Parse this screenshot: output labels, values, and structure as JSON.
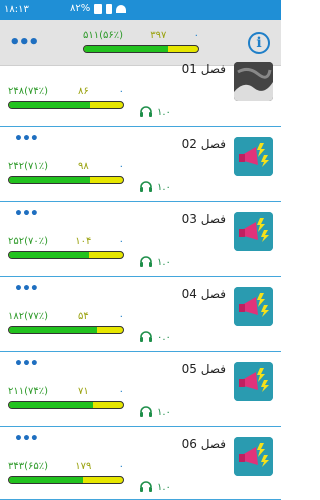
{
  "status": {
    "time": "۱۸:۱۳",
    "battery": "۸۲%"
  },
  "toolbar": {
    "total": "۵۱۱(۵۶٪)",
    "done": "۳۹۷",
    "zero": "۰",
    "progress": 0.74
  },
  "chapters": [
    {
      "title": "فصل 01",
      "total": "۲۴۸(۷۴٪)",
      "done": "۸۶",
      "zero": "۰",
      "speed": "۱.۰",
      "progress": 0.71,
      "thumb": "photo"
    },
    {
      "title": "فصل 02",
      "total": "۲۴۲(۷۱٪)",
      "done": "۹۸",
      "zero": "۰",
      "speed": "۱.۰",
      "progress": 0.71,
      "thumb": "megaphone"
    },
    {
      "title": "فصل 03",
      "total": "۲۵۲(۷۰٪)",
      "done": "۱۰۴",
      "zero": "۰",
      "speed": "۱.۰",
      "progress": 0.7,
      "thumb": "megaphone"
    },
    {
      "title": "فصل 04",
      "total": "۱۸۲(۷۷٪)",
      "done": "۵۴",
      "zero": "۰",
      "speed": "۰.۰",
      "progress": 0.77,
      "thumb": "megaphone"
    },
    {
      "title": "فصل 05",
      "total": "۲۱۱(۷۴٪)",
      "done": "۷۱",
      "zero": "۰",
      "speed": "۱.۰",
      "progress": 0.74,
      "thumb": "megaphone"
    },
    {
      "title": "فصل 06",
      "total": "۳۴۳(۶۵٪)",
      "done": "۱۷۹",
      "zero": "۰",
      "speed": "۱.۰",
      "progress": 0.65,
      "thumb": "megaphone"
    }
  ]
}
